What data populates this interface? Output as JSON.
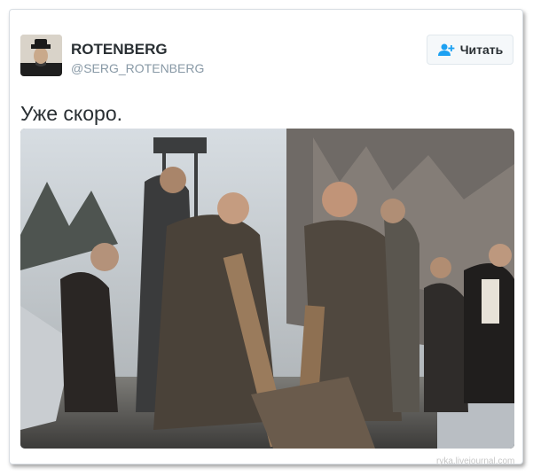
{
  "tweet": {
    "author_name": "ROTENBERG",
    "author_handle": "@SERG_ROTENBERG",
    "follow_label": "Читать",
    "text": "Уже скоро.",
    "avatar_icon": "avatar-photo",
    "follow_icon": "add-user-icon",
    "accent_color": "#1da1f2"
  },
  "photo": {
    "description_icon": "film-still-photo"
  },
  "watermark": {
    "text": "ryka.livejournal.com"
  }
}
